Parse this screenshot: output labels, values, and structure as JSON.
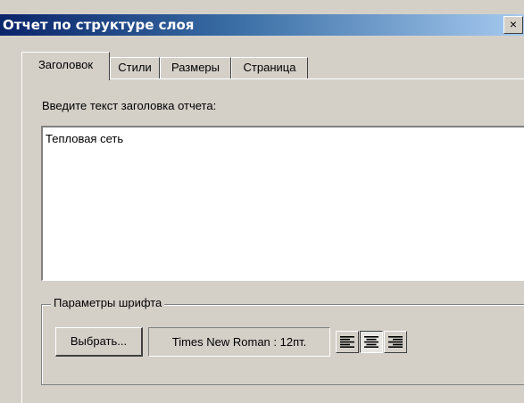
{
  "window": {
    "title": "Отчет по структуре слоя",
    "close_glyph": "×"
  },
  "tabs": [
    {
      "label": "Заголовок",
      "active": true
    },
    {
      "label": "Стили",
      "active": false
    },
    {
      "label": "Размеры",
      "active": false
    },
    {
      "label": "Страница",
      "active": false
    }
  ],
  "header_tab": {
    "prompt": "Введите текст заголовка отчета:",
    "title_text": "Тепловая сеть"
  },
  "font_params": {
    "legend": "Параметры шрифта",
    "choose_button": "Выбрать...",
    "current_font": "Times New Roman : 12пт.",
    "alignment": {
      "options": [
        "left-align-icon",
        "center-align-icon",
        "right-align-icon"
      ],
      "selected": "center"
    }
  }
}
